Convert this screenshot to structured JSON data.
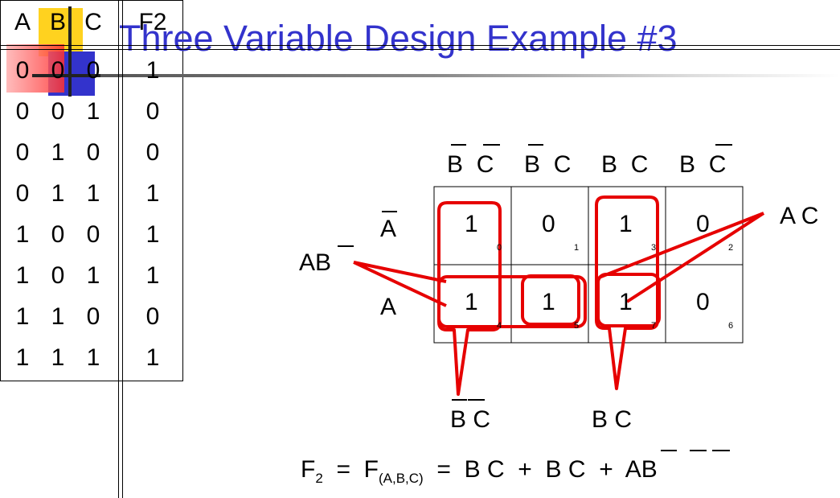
{
  "slide": {
    "title": "Three Variable Design Example #3"
  },
  "truth_table": {
    "headers": [
      "A",
      "B",
      "C",
      "F2"
    ],
    "rows": [
      [
        "0",
        "0",
        "0",
        "1"
      ],
      [
        "0",
        "0",
        "1",
        "0"
      ],
      [
        "0",
        "1",
        "0",
        "0"
      ],
      [
        "0",
        "1",
        "1",
        "1"
      ],
      [
        "1",
        "0",
        "0",
        "1"
      ],
      [
        "1",
        "0",
        "1",
        "1"
      ],
      [
        "1",
        "1",
        "0",
        "0"
      ],
      [
        "1",
        "1",
        "1",
        "1"
      ]
    ]
  },
  "kmap": {
    "col_headers": [
      {
        "v1": "B",
        "v1_bar": true,
        "v2": "C",
        "v2_bar": true
      },
      {
        "v1": "B",
        "v1_bar": true,
        "v2": "C",
        "v2_bar": false
      },
      {
        "v1": "B",
        "v1_bar": false,
        "v2": "C",
        "v2_bar": false
      },
      {
        "v1": "B",
        "v1_bar": false,
        "v2": "C",
        "v2_bar": true
      }
    ],
    "row_headers": [
      {
        "label": "A",
        "bar": true
      },
      {
        "label": "A",
        "bar": false
      }
    ],
    "cells": [
      [
        {
          "value": "1",
          "index": "0"
        },
        {
          "value": "0",
          "index": "1"
        },
        {
          "value": "1",
          "index": "3"
        },
        {
          "value": "0",
          "index": "2"
        }
      ],
      [
        {
          "value": "1",
          "index": "4"
        },
        {
          "value": "1",
          "index": "5"
        },
        {
          "value": "1",
          "index": "7"
        },
        {
          "value": "0",
          "index": "6"
        }
      ]
    ],
    "group_color": "#e60000"
  },
  "callouts": {
    "left_a": "A",
    "left_b": "B",
    "right": "A C",
    "bottom_left_b": "B",
    "bottom_left_c": "C",
    "bottom_right": "B C"
  },
  "equation": {
    "lhs": "F",
    "lhs_sub": "2",
    "eq1": "=",
    "fn": "F",
    "fn_sub": "(A,B,C)",
    "eq2": "=",
    "term1": "B C",
    "plus1": "+",
    "term2_a": "B",
    "term2_b": "C",
    "plus2": "+",
    "term3_a": "A",
    "term3_b": "B"
  }
}
